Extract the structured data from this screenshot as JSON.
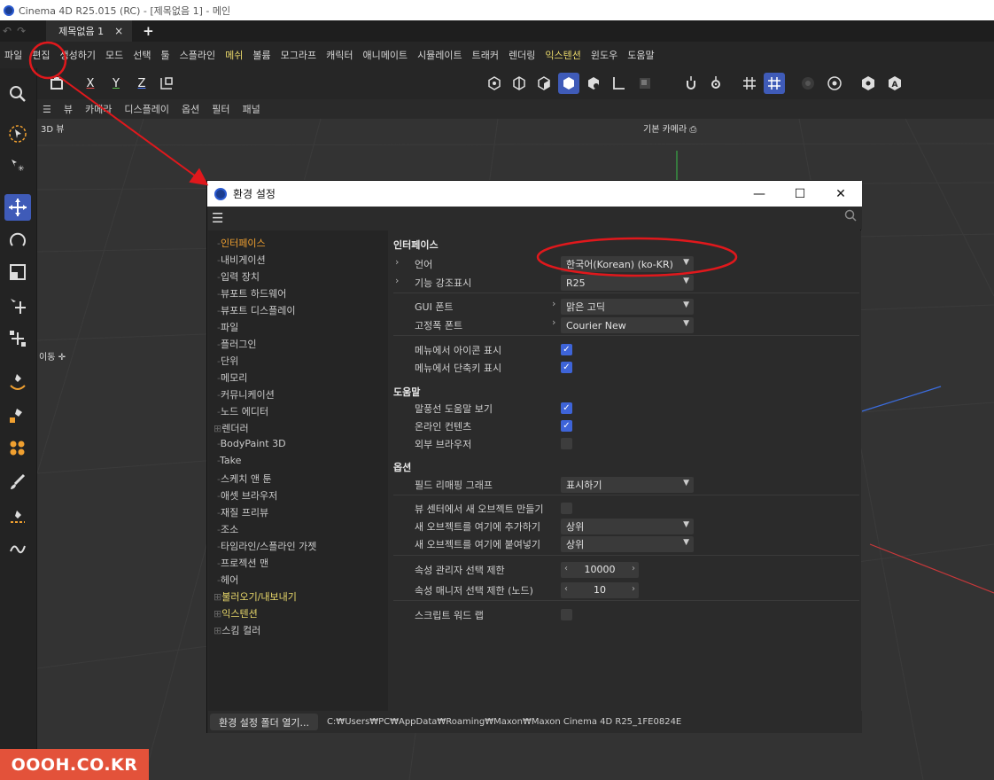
{
  "os": {
    "title": "Cinema 4D R25.015 (RC) - [제목없음 1] - 메인"
  },
  "tabbar": {
    "doc_tab": "제목없음 1",
    "close": "×",
    "add": "+"
  },
  "menubar": {
    "items": [
      "파일",
      "편집",
      "생성하기",
      "모드",
      "선택",
      "툴",
      "스플라인",
      "메쉬",
      "볼륨",
      "모그라프",
      "캐릭터",
      "애니메이트",
      "시뮬레이트",
      "트래커",
      "렌더링",
      "익스텐션",
      "윈도우",
      "도움말"
    ]
  },
  "toolbar": {
    "x": "X",
    "y": "Y",
    "z": "Z"
  },
  "viewport": {
    "menu": [
      "뷰",
      "카메라",
      "디스플레이",
      "옵션",
      "필터",
      "패널"
    ],
    "label": "3D 뷰",
    "camera": "기본 카메라",
    "move": "이동"
  },
  "dialog": {
    "title": "환경 설정",
    "win_min": "—",
    "win_max": "☐",
    "win_close": "✕",
    "nav": [
      {
        "label": "인터페이스",
        "state": "active"
      },
      {
        "label": "내비게이션"
      },
      {
        "label": "입력 장치"
      },
      {
        "label": "뷰포트 하드웨어"
      },
      {
        "label": "뷰포트 디스플레이"
      },
      {
        "label": "파일"
      },
      {
        "label": "플러그인"
      },
      {
        "label": "단위"
      },
      {
        "label": "메모리"
      },
      {
        "label": "커뮤니케이션"
      },
      {
        "label": "노드 에디터"
      },
      {
        "label": "렌더러",
        "expandable": true
      },
      {
        "label": "BodyPaint 3D"
      },
      {
        "label": "Take"
      },
      {
        "label": "스케치 앤 툰"
      },
      {
        "label": "애셋 브라우저"
      },
      {
        "label": "재질 프리뷰"
      },
      {
        "label": "조소"
      },
      {
        "label": "타임라인/스플라인 가젯"
      },
      {
        "label": "프로젝션 맨"
      },
      {
        "label": "헤어"
      },
      {
        "label": "불러오기/내보내기",
        "expandable": true,
        "state": "highlight"
      },
      {
        "label": "익스텐션",
        "expandable": true,
        "state": "highlight"
      },
      {
        "label": "스킴 컬러",
        "expandable": true
      }
    ],
    "interface": {
      "heading": "인터페이스",
      "language_label": "언어",
      "language_value": "한국어(Korean) (ko-KR)",
      "feature_label": "기능 강조표시",
      "feature_value": "R25",
      "gui_font_label": "GUI 폰트",
      "gui_font_value": "맑은 고딕",
      "mono_font_label": "고정폭 폰트",
      "mono_font_value": "Courier New",
      "menu_icons_label": "메뉴에서 아이콘 표시",
      "menu_icons_checked": true,
      "menu_shortcuts_label": "메뉴에서 단축키 표시",
      "menu_shortcuts_checked": true
    },
    "help": {
      "heading": "도움말",
      "tooltip_label": "말풍선 도움말 보기",
      "tooltip_checked": true,
      "online_label": "온라인 컨텐츠",
      "online_checked": true,
      "external_label": "외부 브라우저",
      "external_checked": false
    },
    "options": {
      "heading": "옵션",
      "field_graph_label": "필드 리매핑 그래프",
      "field_graph_value": "표시하기",
      "view_center_label": "뷰 센터에서 새 오브젝트 만들기",
      "view_center_checked": false,
      "add_here_label": "새 오브젝트를 여기에 추가하기",
      "add_here_value": "상위",
      "paste_here_label": "새 오브젝트를 여기에 붙여넣기",
      "paste_here_value": "상위",
      "attr_limit_label": "속성 관리자 선택 제한",
      "attr_limit_value": "10000",
      "attr_node_limit_label": "속성 매니저 선택 제한 (노드)",
      "attr_node_limit_value": "10",
      "script_wrap_label": "스크립트 워드 랩",
      "script_wrap_checked": false
    },
    "footer": {
      "folder_button": "환경 설정 폴더 열기...",
      "path": "C:₩Users₩PC₩AppData₩Roaming₩Maxon₩Maxon Cinema 4D R25_1FE0824E"
    }
  },
  "watermark": "OOOH.CO.KR",
  "colors": {
    "accent_orange": "#f0a030",
    "accent_yellow": "#e9d86a",
    "checkbox_blue": "#3e64d8",
    "annotation_red": "#e0181c"
  }
}
